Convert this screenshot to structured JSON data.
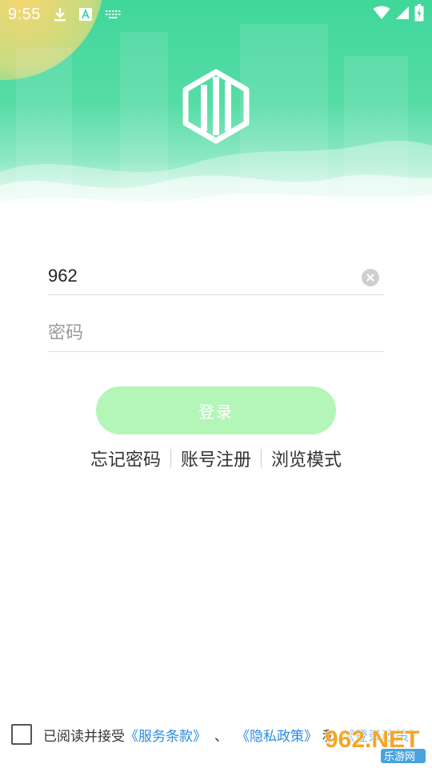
{
  "status_bar": {
    "time": "9:55",
    "icons": [
      "download-icon",
      "keyboard-a-icon",
      "keyboard-icon",
      "wifi-icon",
      "cell-signal-icon",
      "battery-charging-icon"
    ]
  },
  "header": {
    "logo_icon": "building-hexagon-icon",
    "colors": {
      "primary": "#3fd79a",
      "sun": "#ffd66e"
    }
  },
  "form": {
    "username": {
      "value": "962",
      "placeholder": ""
    },
    "password": {
      "value": "",
      "placeholder": "密码"
    },
    "login_label": "登录",
    "login_color": "#b4f5b8"
  },
  "links": {
    "forgot": "忘记密码",
    "register": "账号注册",
    "browse": "浏览模式"
  },
  "agreement": {
    "text": "已阅读并接受",
    "terms": "《服务条款》",
    "sep1": "、",
    "privacy": "《隐私政策》",
    "sep2": "和",
    "third": "《登录政策》",
    "link_color": "#2a8be8"
  },
  "watermark": {
    "logo": "962.NET",
    "sub": "乐游网"
  }
}
